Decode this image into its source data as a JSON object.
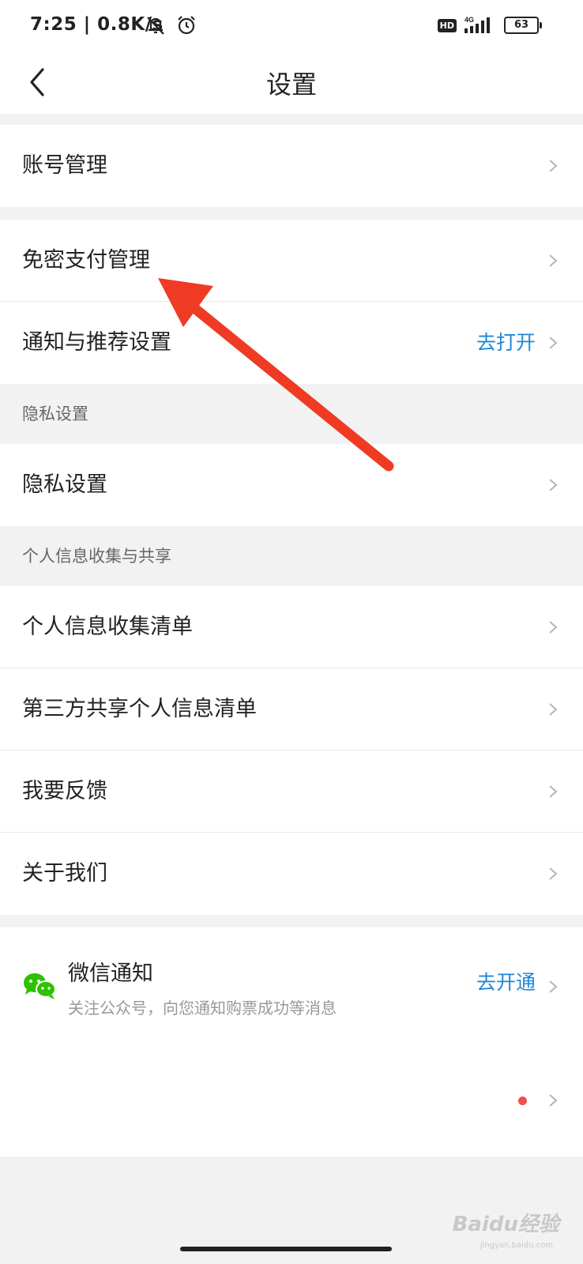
{
  "status_bar": {
    "time": "7:25 | 0.8K/s",
    "hd": "HD",
    "network": "4G",
    "battery": "63"
  },
  "header": {
    "title": "设置"
  },
  "groups": {
    "account": {
      "label": "账号管理"
    },
    "payment": {
      "label": "免密支付管理"
    },
    "notify": {
      "label": "通知与推荐设置",
      "action": "去打开"
    }
  },
  "privacy_section": {
    "header": "隐私设置",
    "item": "隐私设置"
  },
  "info_section": {
    "header": "个人信息收集与共享",
    "items": [
      "个人信息收集清单",
      "第三方共享个人信息清单",
      "我要反馈",
      "关于我们"
    ]
  },
  "wechat": {
    "title": "微信通知",
    "subtitle": "关注公众号，向您通知购票成功等消息",
    "action": "去开通"
  },
  "watermark": {
    "brand": "Baidu经验",
    "url": "jingyan.baidu.com"
  },
  "colors": {
    "accent": "#1e88d8",
    "arrow": "#ef3b24",
    "wechat_green": "#2dc100",
    "dot": "#f0504a"
  }
}
